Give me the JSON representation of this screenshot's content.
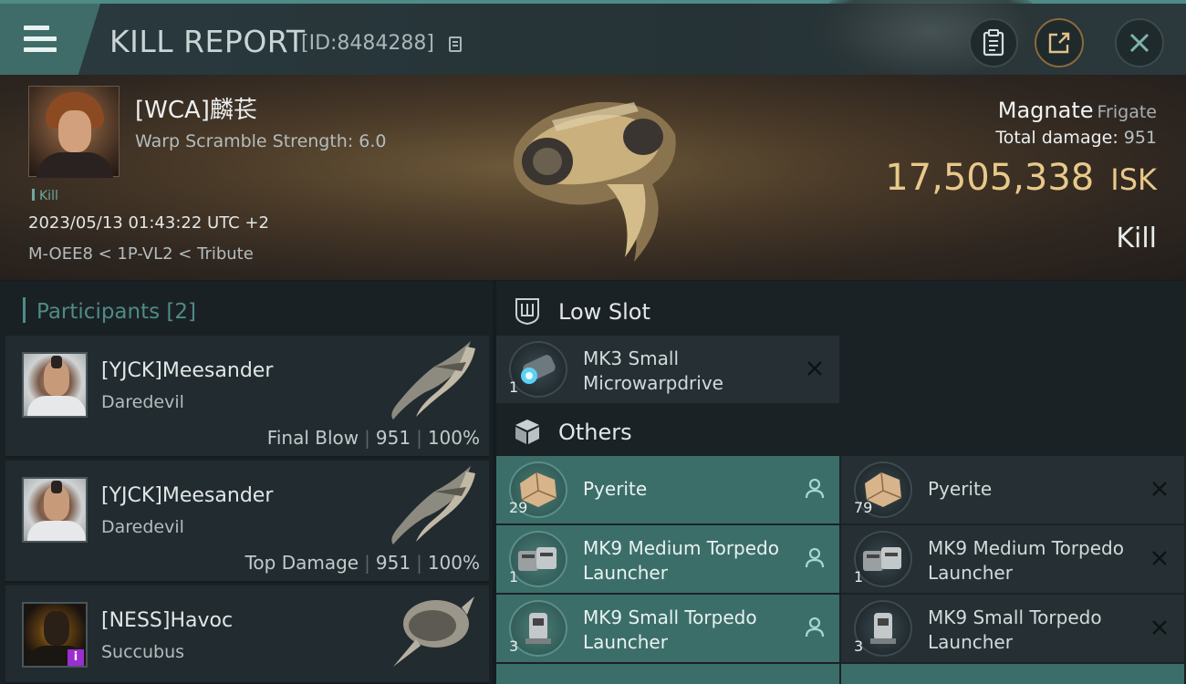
{
  "header": {
    "title": "KILL REPORT",
    "report_id": "[ID:8484288]",
    "menu_icon": "hamburger-icon",
    "copy_icon": "copy-icon",
    "buttons": [
      "clipboard-icon",
      "share-icon",
      "close-icon"
    ]
  },
  "victim": {
    "name": "[WCA]麟苌",
    "warp_scramble": "Warp Scramble Strength: 6.0",
    "kill_tag": "Kill",
    "datetime": "2023/05/13 01:43:22 UTC +2",
    "location": "M-OEE8 < 1P-VL2 < Tribute",
    "ship_name": "Magnate",
    "ship_class": "Frigate",
    "total_damage_label": "Total damage:",
    "total_damage": "951",
    "isk_value": "17,505,338",
    "isk_unit": "ISK",
    "status": "Kill"
  },
  "participants": {
    "header": "Participants [2]",
    "items": [
      {
        "name": "[YJCK]Meesander",
        "ship": "Daredevil",
        "label": "Final Blow",
        "damage": "951",
        "percent": "100%"
      },
      {
        "name": "[YJCK]Meesander",
        "ship": "Daredevil",
        "label": "Top Damage",
        "damage": "951",
        "percent": "100%"
      },
      {
        "name": "[NESS]Havoc",
        "ship": "Succubus",
        "badge": "i"
      }
    ]
  },
  "low_slot": {
    "label": "Low Slot",
    "items": [
      {
        "qty": "1",
        "name": "MK3 Small Microwarpdrive",
        "state": "destroyed"
      }
    ]
  },
  "others": {
    "label": "Others",
    "dropped": [
      {
        "qty": "29",
        "name": "Pyerite"
      },
      {
        "qty": "1",
        "name": "MK9 Medium Torpedo Launcher"
      },
      {
        "qty": "3",
        "name": "MK9 Small Torpedo Launcher"
      }
    ],
    "destroyed": [
      {
        "qty": "79",
        "name": "Pyerite"
      },
      {
        "qty": "1",
        "name": "MK9 Medium Torpedo Launcher"
      },
      {
        "qty": "3",
        "name": "MK9 Small Torpedo Launcher"
      }
    ]
  },
  "colors": {
    "accent_teal": "#4f8b86",
    "dropped_bg": "#3c6e69",
    "isk_gold": "#e8c98a"
  }
}
